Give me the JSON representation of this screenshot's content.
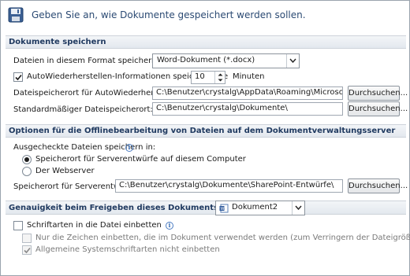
{
  "header": {
    "title": "Geben Sie an, wie Dokumente gespeichert werden sollen.",
    "icon": "save-disk-icon"
  },
  "sections": {
    "save": "Dokumente speichern",
    "offline": "Optionen für die Offlinebearbeitung von Dateien auf dem Dokumentverwaltungsserver",
    "fidelity": "Genauigkeit beim Freigeben dieses Dokuments beibehalten:"
  },
  "save": {
    "format_label": "Dateien in diesem Format speichern:",
    "format_value": "Word-Dokument (*.docx)",
    "autorecover_label": "AutoWiederherstellen-Informationen speichern alle",
    "autorecover_checked": true,
    "autorecover_minutes": "10",
    "minutes_label": "Minuten",
    "autorecover_path_label": "Dateispeicherort für AutoWiederherstellen:",
    "autorecover_path_value": "C:\\Benutzer\\crystalg\\AppData\\Roaming\\Microsoft\\Word\\",
    "default_path_label": "Standardmäßiger Dateispeicherort:",
    "default_path_value": "C:\\Benutzer\\crystalg\\Dokumente\\",
    "browse_label": "Durchsuchen..."
  },
  "offline": {
    "checked_out_label": "Ausgecheckte Dateien speichern in:",
    "radio_server_drafts": "Speicherort für Serverentwürfe auf diesem Computer",
    "radio_server_drafts_selected": true,
    "radio_web_server": "Der Webserver",
    "drafts_path_label": "Speicherort für Serverentwürfe:",
    "drafts_path_value": "C:\\Benutzer\\crystalg\\Dokumente\\SharePoint-Entwürfe\\",
    "browse_label": "Durchsuchen..."
  },
  "fidelity": {
    "document_value": "Dokument2",
    "embed_fonts_label": "Schriftarten in die Datei einbetten",
    "embed_fonts_checked": false,
    "embed_used_chars_label": "Nur die Zeichen einbetten, die im Dokument verwendet werden (zum Verringern der Dateigröße)",
    "embed_used_chars_checked": false,
    "no_system_fonts_label": "Allgemeine Systemschriftarten nicht einbetten",
    "no_system_fonts_checked": true
  },
  "colors": {
    "accent": "#2b4a73",
    "section_text": "#203a60",
    "info": "#2d66b3"
  }
}
